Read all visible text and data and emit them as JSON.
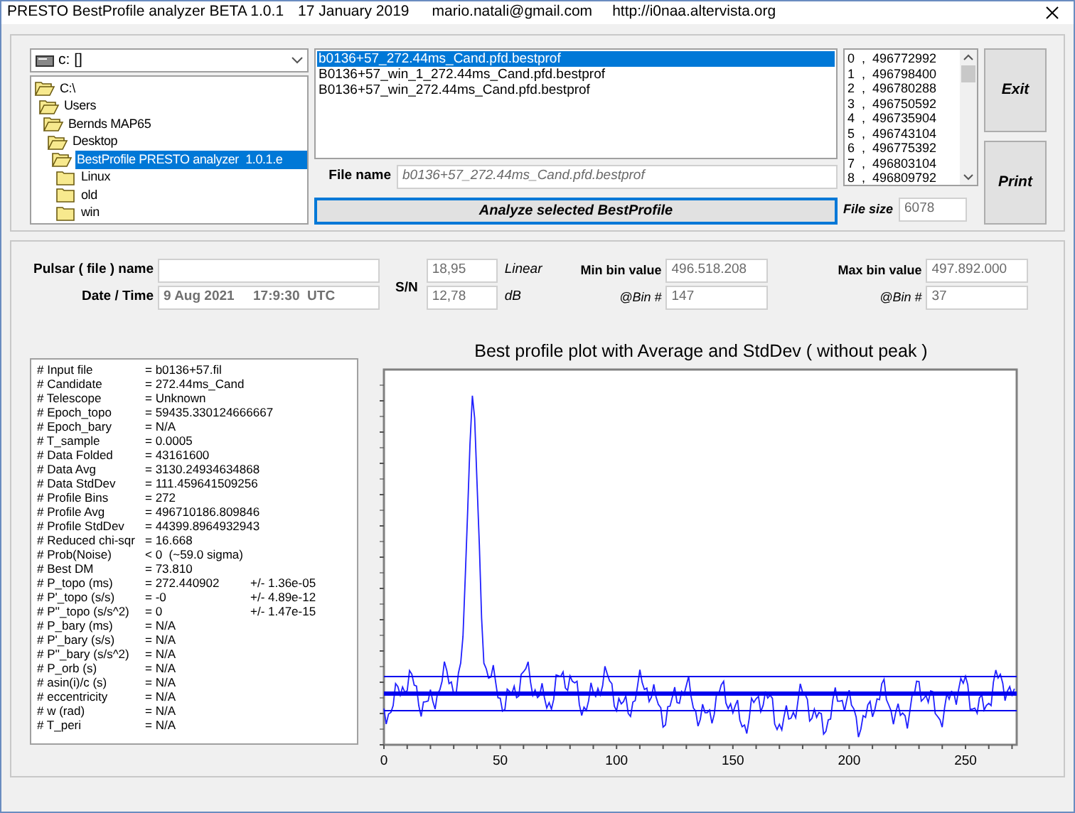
{
  "window": {
    "title_parts": [
      "PRESTO BestProfile analyzer BETA 1.0.1",
      "17 January 2019",
      "mario.natali@gmail.com",
      "http://i0naa.altervista.org"
    ]
  },
  "drive_select": {
    "value": "c: []"
  },
  "folder_tree": [
    {
      "label": "C:\\",
      "expanded": true,
      "selected": false,
      "children": [
        {
          "label": "Users",
          "expanded": true,
          "selected": false,
          "children": [
            {
              "label": "Bernds MAP65",
              "expanded": true,
              "selected": false,
              "children": [
                {
                  "label": "Desktop",
                  "expanded": true,
                  "selected": false,
                  "children": [
                    {
                      "label": "BestProfile PRESTO analyzer  1.0.1.e",
                      "expanded": true,
                      "selected": true,
                      "children": [
                        {
                          "label": "Linux",
                          "expanded": false,
                          "selected": false
                        },
                        {
                          "label": "old",
                          "expanded": false,
                          "selected": false
                        },
                        {
                          "label": "win",
                          "expanded": false,
                          "selected": false
                        }
                      ]
                    }
                  ]
                }
              ]
            }
          ]
        }
      ]
    }
  ],
  "file_list": [
    {
      "label": "b0136+57_272.44ms_Cand.pfd.bestprof",
      "selected": true
    },
    {
      "label": "B0136+57_win_1_272.44ms_Cand.pfd.bestprof",
      "selected": false
    },
    {
      "label": "B0136+57_win_272.44ms_Cand.pfd.bestprof",
      "selected": false
    }
  ],
  "file_name": {
    "label": "File name",
    "value": "b0136+57_272.44ms_Cand.pfd.bestprof"
  },
  "analyze_button": "Analyze selected BestProfile",
  "bin_list": [
    "0  ,  496772992",
    "1  ,  496798400",
    "2  ,  496780288",
    "3  ,  496750592",
    "4  ,  496735904",
    "5  ,  496743104",
    "6  ,  496775392",
    "7  ,  496803104",
    "8  ,  496809792"
  ],
  "file_size": {
    "label": "File size",
    "value": "6078"
  },
  "buttons": [
    "Exit",
    "Print"
  ],
  "pulsar": {
    "label": "Pulsar ( file ) name"
  },
  "date_time": {
    "label": "Date / Time",
    "value": "9 Aug 2021     17:9:30  UTC"
  },
  "sn": {
    "label": "S/N",
    "rows": [
      {
        "value": "18,95",
        "unit": "Linear"
      },
      {
        "value": "12,78",
        "unit": "dB"
      }
    ]
  },
  "min_bin": {
    "label": "Min bin value",
    "value": "496.518.208",
    "bin_label": "@Bin #",
    "bin": "147"
  },
  "max_bin": {
    "label": "Max bin value",
    "value": "497.892.000",
    "bin_label": "@Bin #",
    "bin": "37"
  },
  "header_lines": [
    {
      "key": "# Input file",
      "value": "= b0136+57.fil"
    },
    {
      "key": "# Candidate",
      "value": "= 272.44ms_Cand"
    },
    {
      "key": "# Telescope",
      "value": "= Unknown"
    },
    {
      "key": "# Epoch_topo",
      "value": "= 59435.330124666667"
    },
    {
      "key": "# Epoch_bary",
      "value": "= N/A"
    },
    {
      "key": "# T_sample",
      "value": "= 0.0005"
    },
    {
      "key": "# Data Folded",
      "value": "= 43161600"
    },
    {
      "key": "# Data Avg",
      "value": "= 3130.24934634868"
    },
    {
      "key": "# Data StdDev",
      "value": "= 111.459641509256"
    },
    {
      "key": "# Profile Bins",
      "value": "= 272"
    },
    {
      "key": "# Profile Avg",
      "value": "= 496710186.809846"
    },
    {
      "key": "# Profile StdDev",
      "value": "= 44399.8964932943"
    },
    {
      "key": "# Reduced chi-sqr",
      "value": "= 16.668"
    },
    {
      "key": "# Prob(Noise)",
      "value": "< 0  (~59.0 sigma)"
    },
    {
      "key": "# Best DM",
      "value": "= 73.810"
    },
    {
      "key": "# P_topo (ms)",
      "value": "= 272.440902",
      "error": "+/- 1.36e-05"
    },
    {
      "key": "# P'_topo (s/s)",
      "value": "= -0",
      "error": "+/- 4.89e-12"
    },
    {
      "key": "# P''_topo (s/s^2)",
      "value": "= 0",
      "error": "+/- 1.47e-15"
    },
    {
      "key": "# P_bary (ms)",
      "value": "= N/A"
    },
    {
      "key": "# P'_bary (s/s)",
      "value": "= N/A"
    },
    {
      "key": "# P''_bary (s/s^2)",
      "value": "= N/A"
    },
    {
      "key": "# P_orb (s)",
      "value": "= N/A"
    },
    {
      "key": "# asin(i)/c (s)",
      "value": "= N/A"
    },
    {
      "key": "# eccentricity",
      "value": "= N/A"
    },
    {
      "key": "# w (rad)",
      "value": "= N/A"
    },
    {
      "key": "# T_peri",
      "value": "= N/A"
    }
  ],
  "chart": {
    "title": "Best profile plot with  Average and StdDev ( without peak )",
    "x_tick_labels": [
      "0",
      "50",
      "100",
      "150",
      "200",
      "250"
    ]
  }
}
